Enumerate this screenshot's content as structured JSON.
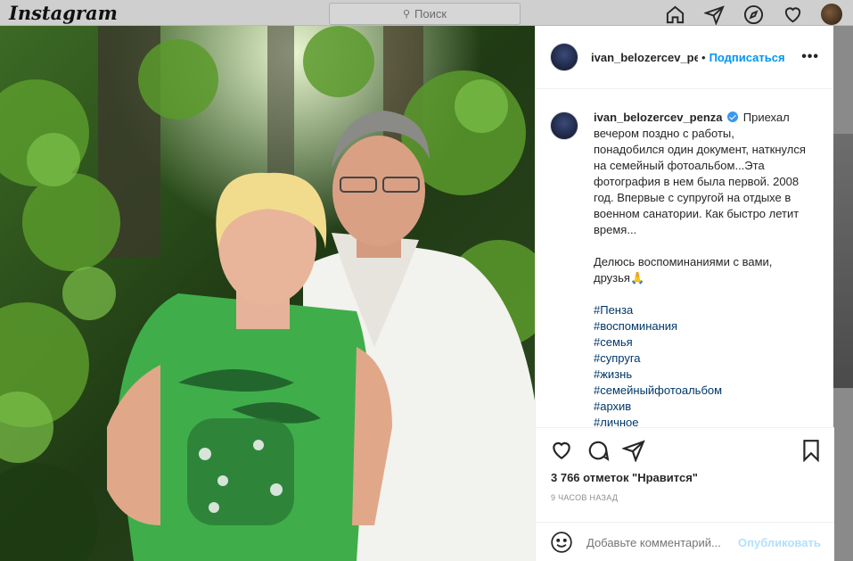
{
  "nav": {
    "logo": "Instagram",
    "search_placeholder": "Поиск",
    "icons": [
      "home-icon",
      "direct-icon",
      "explore-icon",
      "activity-heart-icon",
      "profile-avatar"
    ]
  },
  "post": {
    "photo": {
      "subject": "couple-photo",
      "dominant_colors": [
        "#2d4a1e",
        "#3fae4a",
        "#f2f2ee"
      ]
    },
    "header": {
      "username": "ivan_belozercev_penza",
      "separator": "•",
      "follow_label": "Подписаться",
      "more_label": "•••"
    },
    "caption": {
      "username": "ivan_belozercev_penza",
      "verified": true,
      "text": "Приехал вечером поздно с работы, понадобился один документ, наткнулся на семейный фотоальбом...Эта фотография в нем была первой. 2008 год. Впервые с супругой на отдыхе в военном санатории. Как быстро летит время...",
      "text2": "Делюсь воспоминаниями с вами, друзья🙏",
      "hashtags": [
        "#Пенза",
        "#воспоминания",
        "#семья",
        "#супруга",
        "#жизнь",
        "#семейныйфотоальбом",
        "#архив",
        "#личное"
      ]
    },
    "actions": {
      "icons": [
        "like-heart-icon",
        "comment-icon",
        "share-icon",
        "bookmark-icon"
      ],
      "likes_text": "3 766 отметок \"Нравится\"",
      "time_text": "9 ЧАСОВ НАЗАД"
    },
    "comment": {
      "placeholder": "Добавьте комментарий...",
      "publish_label": "Опубликовать"
    },
    "colors": {
      "accent": "#0095f6",
      "hashtag": "#00376b",
      "publish_disabled": "#b2dffc"
    }
  }
}
